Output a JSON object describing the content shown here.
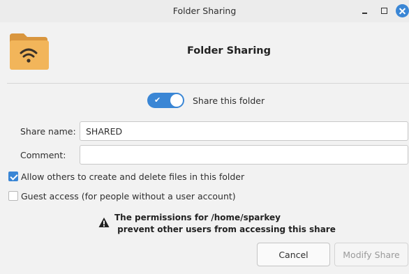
{
  "window": {
    "title": "Folder Sharing"
  },
  "header": {
    "title": "Folder Sharing",
    "icon": "folder-share-icon"
  },
  "share_toggle": {
    "label": "Share this folder",
    "on": true
  },
  "form": {
    "share_name_label": "Share name:",
    "share_name_value": "SHARED",
    "comment_label": "Comment:",
    "comment_value": ""
  },
  "options": {
    "allow_others_label": "Allow others to create and delete files in this folder",
    "allow_others_checked": true,
    "guest_access_label": "Guest access (for people without a user account)",
    "guest_access_checked": false
  },
  "warning": {
    "line1": "The permissions for /home/sparkey",
    "line2": " prevent other users from accessing this share"
  },
  "buttons": {
    "cancel": "Cancel",
    "modify": "Modify Share"
  },
  "colors": {
    "accent": "#3a86d5",
    "folder": "#f2b55a"
  }
}
